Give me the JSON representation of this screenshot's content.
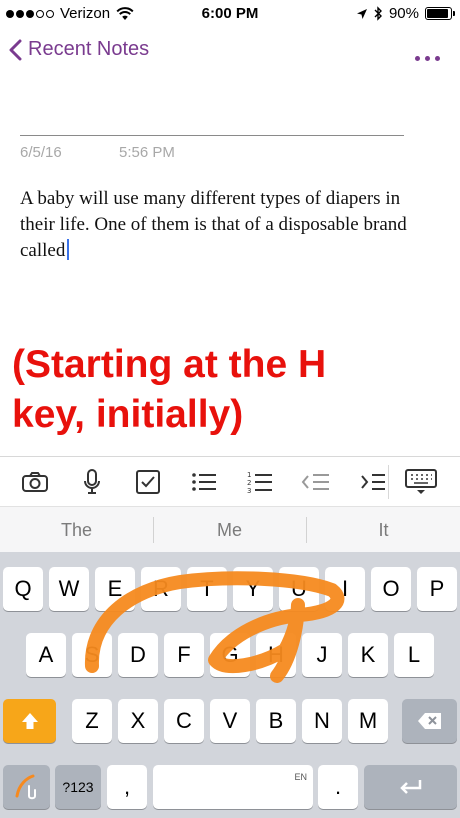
{
  "status_bar": {
    "carrier": "Verizon",
    "time": "6:00 PM",
    "battery": "90%",
    "battery_level": 0.9,
    "signal_bars": 3
  },
  "nav": {
    "back_label": "Recent Notes"
  },
  "note": {
    "date": "6/5/16",
    "time": "5:56 PM",
    "text": "A baby will use many different types of diapers in their life. One of them is that of a disposable brand called"
  },
  "annotation": {
    "line1": "(Starting at the H",
    "line2": "key, initially)"
  },
  "toolbar": {
    "icons": [
      "camera-icon",
      "microphone-icon",
      "checkbox-icon",
      "bullet-list-icon",
      "numbered-list-icon",
      "outdent-icon",
      "indent-icon",
      "keyboard-hide-icon"
    ]
  },
  "predictions": [
    "The",
    "Me",
    "It"
  ],
  "keyboard": {
    "row1": [
      "Q",
      "W",
      "E",
      "R",
      "T",
      "Y",
      "U",
      "I",
      "O",
      "P"
    ],
    "row2": [
      "A",
      "S",
      "D",
      "F",
      "G",
      "H",
      "J",
      "K",
      "L"
    ],
    "row3": [
      "Z",
      "X",
      "C",
      "V",
      "B",
      "N",
      "M"
    ],
    "numbers_key": "?123",
    "comma_key": ",",
    "space_lang": "EN",
    "period_key": ".",
    "icons": {
      "shift": "shift-arrow-icon",
      "backspace": "backspace-icon",
      "return": "return-arrow-icon",
      "swype": "swype-logo-icon"
    }
  },
  "colors": {
    "accent": "#7a3b8f",
    "annotation": "#e8110c",
    "swipe_trace": "#f68a1f",
    "shift_key": "#f7a619",
    "cursor": "#3b73e8"
  }
}
